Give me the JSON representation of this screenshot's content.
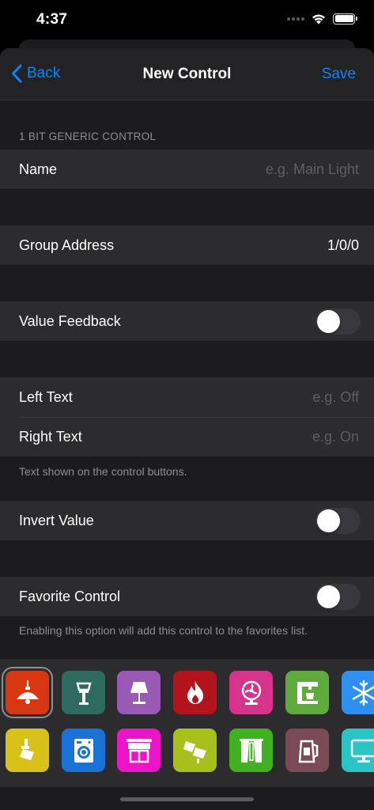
{
  "status": {
    "time": "4:37"
  },
  "nav": {
    "back_label": "Back",
    "title": "New Control",
    "save_label": "Save"
  },
  "section": {
    "header": "1 BIT GENERIC CONTROL"
  },
  "fields": {
    "name": {
      "label": "Name",
      "placeholder": "e.g. Main Light"
    },
    "group_address": {
      "label": "Group Address",
      "value": "1/0/0"
    },
    "value_feedback": {
      "label": "Value Feedback",
      "on": false
    },
    "left_text": {
      "label": "Left Text",
      "placeholder": "e.g. Off"
    },
    "right_text": {
      "label": "Right Text",
      "placeholder": "e.g. On"
    },
    "buttons_footer": "Text shown on the control buttons.",
    "invert_value": {
      "label": "Invert Value",
      "on": false
    },
    "favorite_control": {
      "label": "Favorite Control",
      "on": false
    },
    "favorite_footer": "Enabling this option will add this control to the favorites list."
  },
  "icons": [
    {
      "name": "pendant-lamp-icon",
      "color": "#d9370f",
      "selected": true
    },
    {
      "name": "garden-lamp-icon",
      "color": "#2e6b5e"
    },
    {
      "name": "table-lamp-icon",
      "color": "#9b59b6"
    },
    {
      "name": "fire-icon",
      "color": "#b3131b"
    },
    {
      "name": "fan-icon",
      "color": "#d6338a"
    },
    {
      "name": "coffee-machine-icon",
      "color": "#5faa3c"
    },
    {
      "name": "snowflake-icon",
      "color": "#2d8ff0"
    },
    {
      "name": "spotlight-icon",
      "color": "#d8c21a"
    },
    {
      "name": "washing-machine-icon",
      "color": "#1a72d6"
    },
    {
      "name": "awning-icon",
      "color": "#ee12c9"
    },
    {
      "name": "double-spotlight-icon",
      "color": "#a8c01c"
    },
    {
      "name": "curtains-icon",
      "color": "#42b121"
    },
    {
      "name": "kettle-icon",
      "color": "#7a4b55"
    },
    {
      "name": "monitor-icon",
      "color": "#2bc4c4"
    }
  ]
}
